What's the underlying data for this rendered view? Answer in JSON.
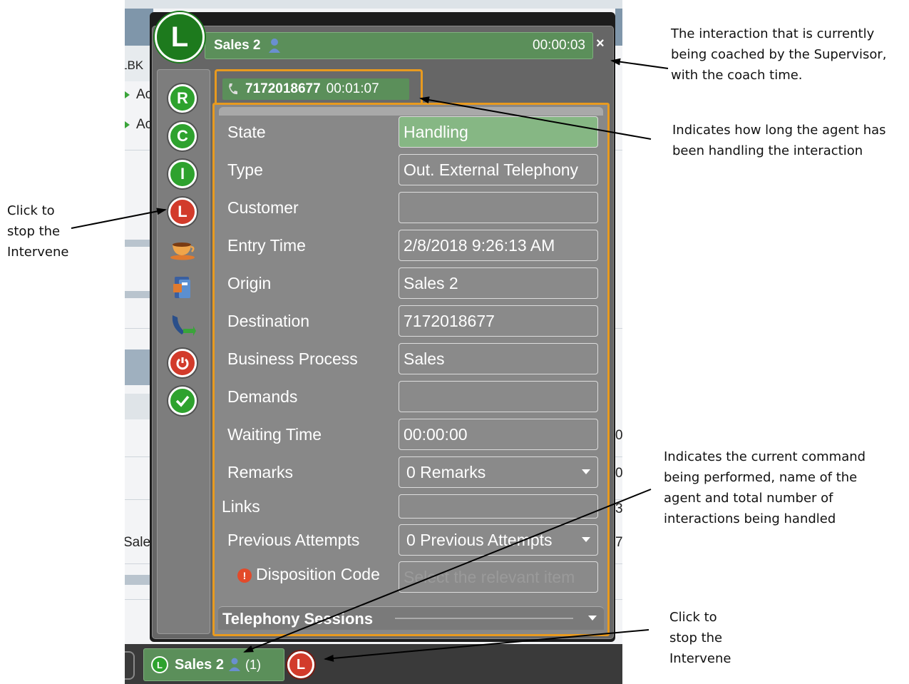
{
  "background_app": {
    "column_header": "LBK",
    "row_texts": [
      "Ac",
      "Ac"
    ],
    "right_digits": [
      "0",
      "0",
      "3",
      "7"
    ],
    "left_row_text": "Sale"
  },
  "popup": {
    "logo_letter": "L",
    "title": "Sales 2",
    "coach_time": "00:00:03",
    "close_label": "×",
    "tab": {
      "number": "7172018677",
      "time": "00:01:07"
    },
    "sidebar": {
      "icons": [
        {
          "name": "record-icon",
          "letter": "R",
          "color": "green"
        },
        {
          "name": "coach-icon",
          "letter": "C",
          "color": "green"
        },
        {
          "name": "intervene-icon",
          "letter": "I",
          "color": "green"
        },
        {
          "name": "stop-intervene-icon",
          "letter": "L",
          "color": "red"
        },
        {
          "name": "break-cup-icon"
        },
        {
          "name": "phonebook-icon"
        },
        {
          "name": "transfer-phone-icon"
        },
        {
          "name": "power-icon"
        },
        {
          "name": "check-icon"
        }
      ]
    },
    "form": {
      "state": {
        "label": "State",
        "value": "Handling"
      },
      "type": {
        "label": "Type",
        "value": "Out. External Telephony"
      },
      "customer": {
        "label": "Customer",
        "value": ""
      },
      "entry_time": {
        "label": "Entry Time",
        "value": "2/8/2018 9:26:13 AM"
      },
      "origin": {
        "label": "Origin",
        "value": "Sales 2"
      },
      "destination": {
        "label": "Destination",
        "value": "7172018677"
      },
      "business_process": {
        "label": "Business Process",
        "value": "Sales"
      },
      "demands": {
        "label": "Demands",
        "value": ""
      },
      "waiting_time": {
        "label": "Waiting Time",
        "value": "00:00:00"
      },
      "remarks": {
        "label": "Remarks",
        "value": "0 Remarks"
      },
      "links": {
        "label": "Links",
        "value": ""
      },
      "previous_attempts": {
        "label": "Previous Attempts",
        "value": "0 Previous Attempts"
      },
      "disposition_code": {
        "label": "Disposition Code",
        "placeholder": "Select the relevant item"
      }
    },
    "telephony_sessions": "Telephony Sessions"
  },
  "bottom_bar": {
    "logo_letter": "L",
    "agent": "Sales 2",
    "count": "(1)",
    "stop_letter": "L"
  },
  "annotations": {
    "coach_interaction": "The interaction that is currently being coached by the Supervisor, with the coach time.",
    "handling_time": "Indicates how long the agent has been handling the interaction",
    "stop_intervene_left": "Click to stop the Intervene",
    "current_command": "Indicates the current command being performed, name of the agent and total number of interactions being handled",
    "stop_intervene_bottom": "Click to stop the Intervene"
  },
  "colors": {
    "accent_green": "#5b8f5a",
    "state_green": "#86b784",
    "orange_border": "#e89a1f",
    "stop_red": "#d23b2b"
  }
}
